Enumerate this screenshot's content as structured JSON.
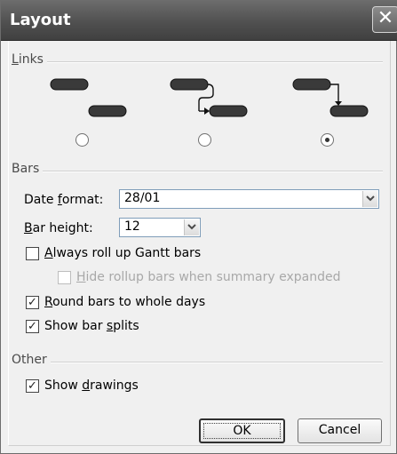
{
  "window": {
    "title": "Layout",
    "close_label": "✕"
  },
  "links": {
    "group_label_u": "L",
    "group_label_rest": "inks",
    "options": [
      {
        "name": "no-connector",
        "selected": false
      },
      {
        "name": "right-angle-connector",
        "selected": false
      },
      {
        "name": "step-connector",
        "selected": true
      }
    ]
  },
  "bars": {
    "group_label": "Bars",
    "date_format": {
      "label_pre": "Date ",
      "label_u": "f",
      "label_post": "ormat:",
      "value": "28/01"
    },
    "bar_height": {
      "label_u": "B",
      "label_post": "ar height:",
      "value": "12"
    },
    "always_roll_up": {
      "label_u": "A",
      "label_post": "lways roll up Gantt bars",
      "checked": false
    },
    "hide_rollup": {
      "label_u": "H",
      "label_post": "ide rollup bars when summary expanded",
      "checked": false,
      "enabled": false
    },
    "round_bars": {
      "label_u": "R",
      "label_post": "ound bars to whole days",
      "checked": true
    },
    "show_splits": {
      "label_pre": "Show bar ",
      "label_u": "s",
      "label_post": "plits",
      "checked": true
    }
  },
  "other": {
    "group_label": "Other",
    "show_drawings": {
      "label_pre": "Show ",
      "label_u": "d",
      "label_post": "rawings",
      "checked": true
    }
  },
  "buttons": {
    "ok": "OK",
    "cancel": "Cancel"
  },
  "check_glyph": "✓"
}
